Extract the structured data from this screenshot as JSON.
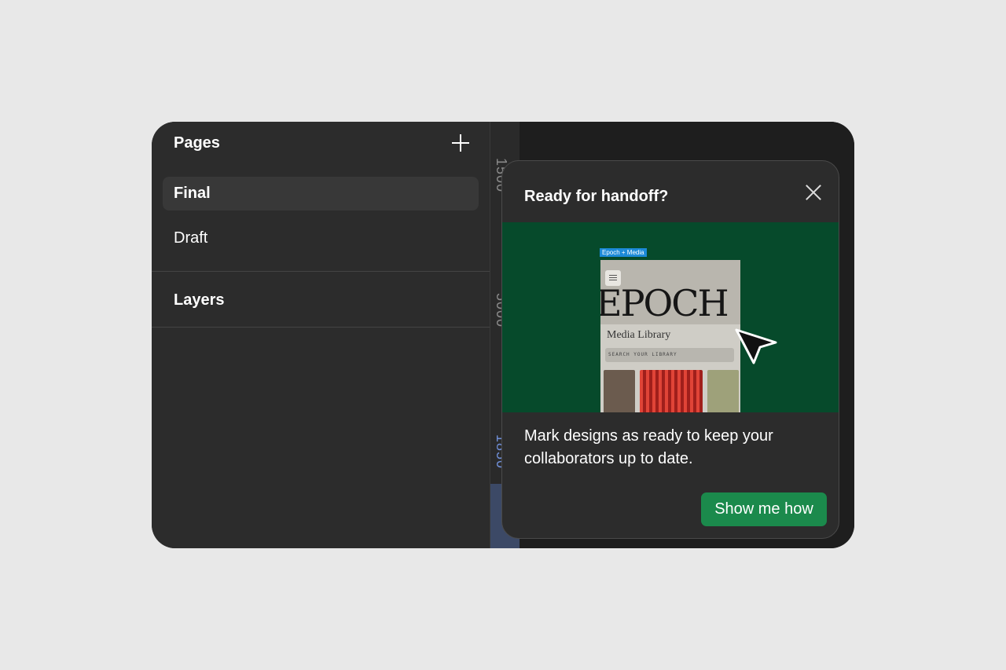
{
  "sidebar": {
    "pages_title": "Pages",
    "pages": [
      {
        "label": "Final",
        "active": true
      },
      {
        "label": "Draft",
        "active": false
      }
    ],
    "layers_title": "Layers"
  },
  "ruler": {
    "labels": [
      "1500",
      "5000",
      "1850"
    ]
  },
  "popup": {
    "title": "Ready for handoff?",
    "body": "Mark designs as ready to keep your collaborators up to date.",
    "cta_label": "Show me how",
    "preview": {
      "frame_tag": "Epoch + Media",
      "mock_title": "EPOCH",
      "mock_subtitle": "Media Library",
      "mock_search_placeholder": "SEARCH YOUR LIBRARY"
    }
  },
  "colors": {
    "preview_background": "#064a2b",
    "cta_background": "#1b8a4c",
    "frame_tag": "#1c8ad8"
  }
}
